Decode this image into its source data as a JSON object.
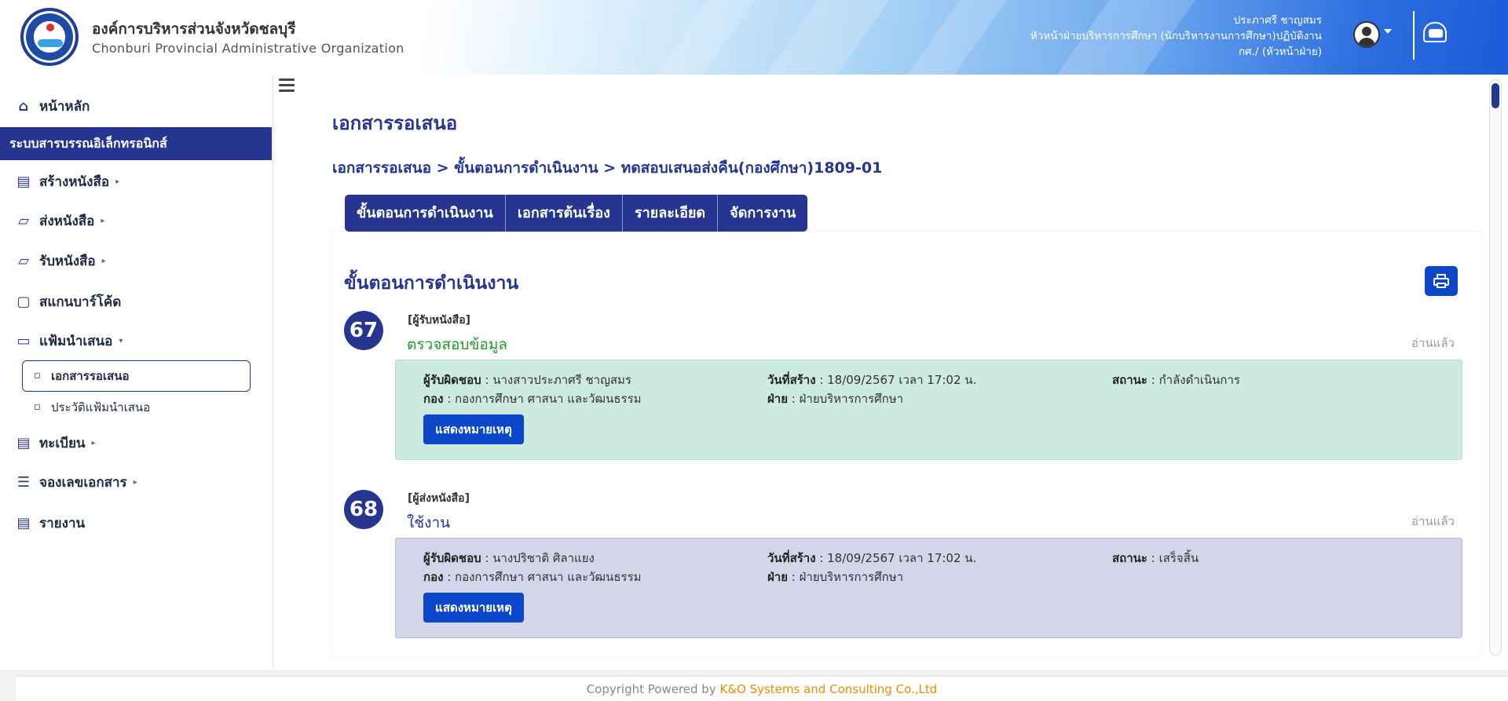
{
  "header": {
    "org_name_th": "องค์การบริหารส่วนจังหวัดชลบุรี",
    "org_name_en": "Chonburi Provincial Administrative Organization",
    "user_name": "ประภาศรี ชาญสมร",
    "user_position": "หัวหน้าฝ่ายบริหารการศึกษา (นักบริหารงานการศึกษา)ปฏิบัติงาน",
    "user_role": "กศ./ (หัวหน้าฝ่าย)"
  },
  "sidebar": {
    "home": "หน้าหลัก",
    "section": "ระบบสารบรรณอิเล็กทรอนิกส์",
    "items": [
      {
        "label": "สร้างหนังสือ",
        "icon": "clipboard-icon",
        "has_caret": true
      },
      {
        "label": "ส่งหนังสือ",
        "icon": "send-document-icon",
        "has_caret": true
      },
      {
        "label": "รับหนังสือ",
        "icon": "receive-document-icon",
        "has_caret": true
      },
      {
        "label": "สแกนบาร์โค้ด",
        "icon": "barcode-scan-icon",
        "has_caret": false
      },
      {
        "label": "แฟ้มนำเสนอ",
        "icon": "folder-icon",
        "has_caret": true
      },
      {
        "label": "ทะเบียน",
        "icon": "register-icon",
        "has_caret": true
      },
      {
        "label": "จองเลขเอกสาร",
        "icon": "reserve-number-icon",
        "has_caret": true
      },
      {
        "label": "รายงาน",
        "icon": "report-icon",
        "has_caret": false
      }
    ],
    "sub_items": [
      "เอกสารรอเสนอ",
      "ประวัติแฟ้มนำเสนอ"
    ],
    "caret": "▸",
    "caret_open": "▾"
  },
  "main": {
    "title": "เอกสารรอเสนอ",
    "breadcrumb": "เอกสารรอเสนอ > ขั้นตอนการดำเนินงาน > ทดสอบเสนอส่งคืน(กองศึกษา)1809-01",
    "tabs": [
      "ขั้นตอนการดำเนินงาน",
      "เอกสารต้นเรื่อง",
      "รายละเอียด",
      "จัดการงาน"
    ],
    "section_title": "ขั้นตอนการดำเนินงาน",
    "steps": [
      {
        "number": "67",
        "role": "[ผู้รับหนังสือ]",
        "action": "ตรวจสอบข้อมูล",
        "action_color": "#1f9a2a",
        "read_status": "อ่านแล้ว",
        "responsible_label": "ผู้รับผิดชอบ",
        "responsible": " : นางสาวประภาศรี ชาญสมร",
        "created_label": "วันที่สร้าง",
        "created": " : 18/09/2567 เวลา 17:02 น.",
        "status_label": "สถานะ",
        "status": " : กำลังดำเนินการ",
        "division_label": "กอง",
        "division": " : กองการศึกษา ศาสนา และวัฒนธรรม",
        "section_label": "ฝ่าย",
        "section": " : ฝ่ายบริหารการศึกษา",
        "note_button": "แสดงหมายเหตุ"
      },
      {
        "number": "68",
        "role": "[ผู้ส่งหนังสือ]",
        "action": "ใช้งาน",
        "action_color": "#263590",
        "read_status": "อ่านแล้ว",
        "responsible_label": "ผู้รับผิดชอบ",
        "responsible": " : นางปริชาติ ศิลาแยง",
        "created_label": "วันที่สร้าง",
        "created": " : 18/09/2567 เวลา 17:02 น.",
        "status_label": "สถานะ",
        "status": " : เสร็จสิ้น",
        "division_label": "กอง",
        "division": " : กองการศึกษา ศาสนา และวัฒนธรรม",
        "section_label": "ฝ่าย",
        "section": " : ฝ่ายบริหารการศึกษา",
        "note_button": "แสดงหมายเหตุ"
      }
    ]
  },
  "footer": {
    "prefix": "Copyright Powered by ",
    "company": "K&O Systems and Consulting Co.,Ltd"
  },
  "colors": {
    "primary": "#263590",
    "button_blue": "#0d47c9",
    "step_green_bg": "#cdeae1",
    "step_lavender_bg": "#d3d5e9",
    "footer_company": "#f08c00"
  }
}
